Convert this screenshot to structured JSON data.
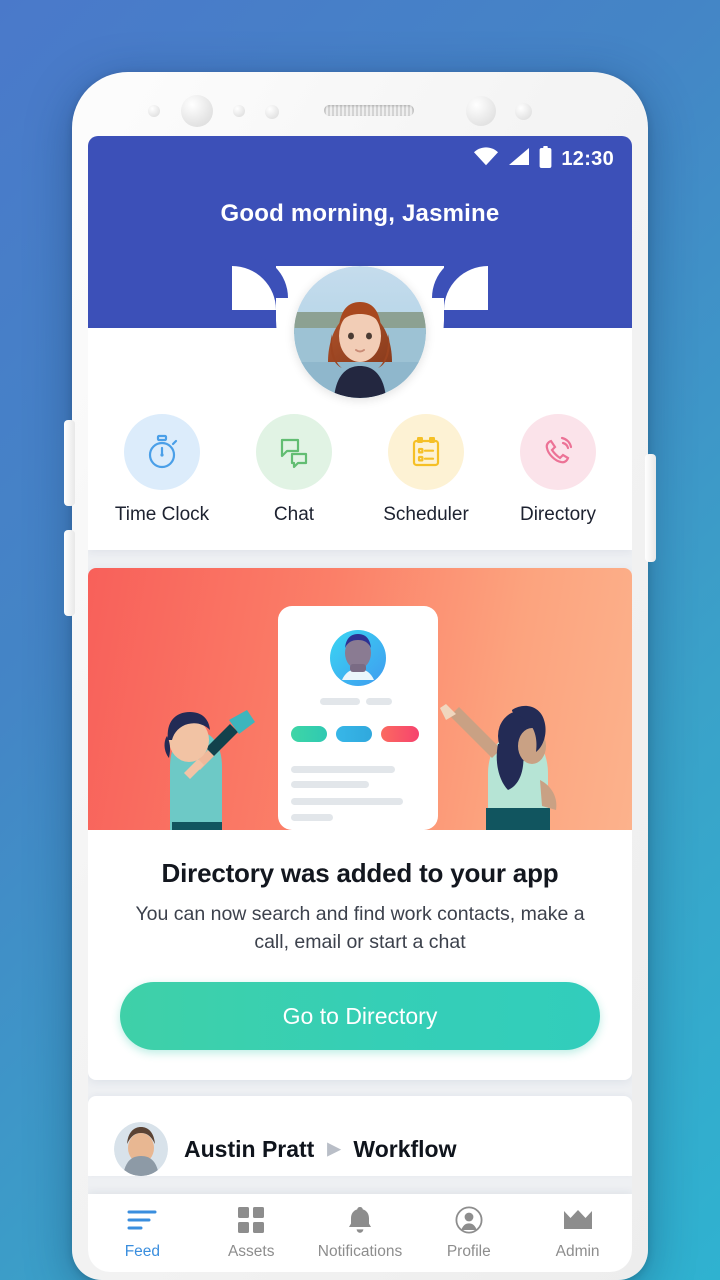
{
  "device": {
    "hardware": {
      "front_camera": "front-camera",
      "earpiece_speaker": "earpiece-speaker",
      "volume_up": "volume-up-button",
      "volume_down": "volume-down-button",
      "power": "power-button"
    }
  },
  "status_bar": {
    "time": "12:30",
    "icons": [
      "wifi-icon",
      "cellular-signal-icon",
      "battery-icon"
    ]
  },
  "header": {
    "greeting": "Good morning, Jasmine",
    "user_name": "Jasmine",
    "background_color": "#3c50b8",
    "avatar": "user-avatar"
  },
  "quick_actions": [
    {
      "label": "Time Clock",
      "icon": "stopwatch-icon",
      "icon_color": "#4a9fe8",
      "circle_color": "#dcecfb"
    },
    {
      "label": "Chat",
      "icon": "chat-bubbles-icon",
      "icon_color": "#62bd72",
      "circle_color": "#e1f3e4"
    },
    {
      "label": "Scheduler",
      "icon": "clipboard-calendar-icon",
      "icon_color": "#f5c026",
      "circle_color": "#fdf2d4"
    },
    {
      "label": "Directory",
      "icon": "phone-ringing-icon",
      "icon_color": "#ec7296",
      "circle_color": "#fbe3ea"
    }
  ],
  "promo_card": {
    "illustration": "directory-announcement-illustration",
    "title": "Directory was added to your app",
    "subtitle": "You can now search and find work contacts, make a call, email or start a chat",
    "cta_label": "Go to Directory",
    "cta_color": "#35cfb6",
    "background_gradient": [
      "#f8605a",
      "#fcb28c"
    ]
  },
  "feed": [
    {
      "author": "Austin Pratt",
      "separator": "▶",
      "channel": "Workflow",
      "avatar": "feed-author-avatar"
    }
  ],
  "bottom_nav": {
    "active": "Feed",
    "active_color": "#3a8ede",
    "items": [
      {
        "label": "Feed",
        "icon": "feed-lines-icon"
      },
      {
        "label": "Assets",
        "icon": "grid-squares-icon"
      },
      {
        "label": "Notifications",
        "icon": "bell-icon"
      },
      {
        "label": "Profile",
        "icon": "person-circle-icon"
      },
      {
        "label": "Admin",
        "icon": "crown-icon"
      }
    ]
  }
}
